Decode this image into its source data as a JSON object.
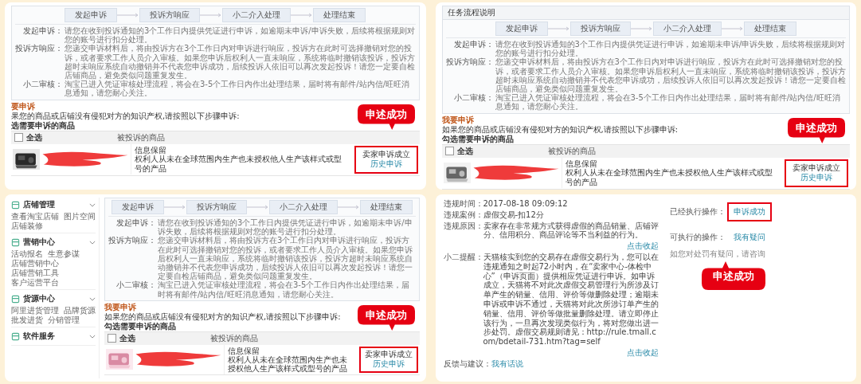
{
  "panels": [
    {
      "kind": "complaint",
      "steps": [
        "发起申诉",
        "投诉方响应",
        "小二介入处理",
        "处理结束"
      ],
      "notes": [
        {
          "label": "发起申诉：",
          "text": "请您在收到投诉通知的3个工作日内提供凭证进行申诉，如逾期未申诉/申诉失败，后续将根据规则对您的账号进行扣分处理。"
        },
        {
          "label": "投诉方响应：",
          "text": "您递交申诉材料后，将由投诉方在3个工作日内对申诉进行响应，投诉方在此时可选择撤销对您的投诉，或者要求工作人员介入审核。如果您申诉后权利人一直未响应，系统将临时撤销该投诉，投诉方超时未响应系统自动撤销并不代表您申诉成功，后续投诉人依旧可以再次发起投诉！请您一定要自检店铺商品，避免类似问题重复发生。"
        },
        {
          "label": "小二审核：",
          "text": "淘宝已进入凭证审核处理流程，将会在3-5个工作日内作出处理结果，届时将有邮件/站内信/旺旺消息通知，请您耐心关注。"
        }
      ],
      "section_title": "要申诉",
      "intro": "果您的商品或店铺没有侵犯对方的知识产权,请按照以下步骤申诉:",
      "select_label": "选需要申诉的商品",
      "table": {
        "select_all": {
          "label": "全选",
          "checked": false
        },
        "column": "被投诉的商品",
        "rows": [
          {
            "description_title": "信息保留",
            "description": "权利人从未在全球范围内生产也未授权他人生产该样式或型号的产品",
            "status": "卖家申诉成立",
            "link": "历史申诉",
            "highlighted": true
          }
        ]
      },
      "callout": "申述成功"
    },
    {
      "kind": "complaint",
      "header": "任务流程说明",
      "steps": [
        "发起申诉",
        "投诉方响应",
        "小二介入处理",
        "处理结束"
      ],
      "notes": [
        {
          "label": "发起申诉：",
          "text": "请您在收到投诉通知的3个工作日内提供凭证进行申诉，如逾期未申诉/申诉失败，后续将根据规则对您的账号进行扣分处理。"
        },
        {
          "label": "投诉方响应：",
          "text": "您递交申诉材料后，将由投诉方在3个工作日内对申诉进行响应，投诉方在此时可选择撤销对您的投诉，或者要求工作人员介入审核。如果您申诉后权利人一直未响应，系统将临时撤销该投诉，投诉方超时未响应系统自动撤销并不代表您申诉成功，后续投诉人依旧可以再次发起投诉！请您一定要自检店铺商品，避免类似问题重复发生。"
        },
        {
          "label": "小二审核：",
          "text": "淘宝已进入凭证审核处理流程，将会在3-5个工作日内作出处理结果，届时将有邮件/站内信/旺旺消息通知，请您耐心关注。"
        }
      ],
      "section_title": "我要申诉",
      "intro": "如果您的商品或店铺没有侵犯对方的知识产权,请按照以下步骤申诉:",
      "select_label": "勾选需要申诉的商品",
      "table": {
        "select_all": {
          "label": "全选",
          "checked": false
        },
        "column": "被投诉的商品",
        "rows": [
          {
            "description_title": "信息保留",
            "description": "权利人从未在全球范围内生产也未授权他人生产该样式或型号的产品",
            "status": "卖家申诉成立",
            "link": "历史申诉",
            "highlighted": true
          }
        ]
      },
      "callout": "申述成功"
    },
    {
      "kind": "complaint",
      "sidebar": [
        {
          "title": "店铺管理",
          "items": [
            "查看淘宝店铺",
            "图片空间",
            "店铺装修"
          ]
        },
        {
          "title": "营销中心",
          "items": [
            "活动报名",
            "生意参谋",
            "店铺营销中心",
            "店铺营销工具",
            "客户运营平台"
          ]
        },
        {
          "title": "货源中心",
          "items": [
            "阿里进货管理",
            "品牌货源",
            "批发进货",
            "分销管理"
          ]
        },
        {
          "title": "软件服务"
        }
      ],
      "steps": [
        "发起申诉",
        "投诉方响应",
        "小二介入处理",
        "处理结束"
      ],
      "notes": [
        {
          "label": "发起申诉：",
          "text": "请您在收到投诉通知的3个工作日内提供凭证进行申诉，如逾期未申诉/申诉失败，后续将根据规则对您的账号进行扣分处理。"
        },
        {
          "label": "投诉方响应：",
          "text": "您递交申诉材料后，将由投诉方在3个工作日内对申诉进行响应，投诉方在此时可选择撤销对您的投诉，或者要求工作人员介入审核。如果您申诉后权利人一直未响应，系统将临时撤销该投诉，投诉方超时未响应系统自动撤销并不代表您申诉成功，后续投诉人依旧可以再次发起投诉！请您一定要自检店铺商品，避免类似问题重复发生。"
        },
        {
          "label": "小二审核：",
          "text": "淘宝已进入凭证审核处理流程，将会在3-5个工作日内作出处理结果，届时将有邮件/站内信/旺旺消息通知，请您耐心关注。"
        }
      ],
      "section_title": "我要申诉",
      "intro": "如果您的商品或店铺没有侵犯对方的知识产权,请按照以下步骤申诉:",
      "select_label": "勾选需要申诉的商品",
      "table": {
        "select_all": {
          "label": "全选",
          "checked": false
        },
        "column": "被投诉的商品",
        "rows": [
          {
            "description_title": "信息保留",
            "description": "权利人从未在全球范围内生产也未授权他人生产该样式或型号的产品",
            "status": "卖家申诉成立",
            "link": "历史申诉",
            "highlighted": true
          }
        ]
      },
      "callout": "申述成功"
    },
    {
      "kind": "violation",
      "fields": [
        {
          "kind": "field",
          "label": "违规时间：",
          "value": "2017-08-18 09:09:12"
        },
        {
          "kind": "field",
          "label": "违规案例：",
          "value": "虚假交易-扣12分"
        },
        {
          "kind": "field",
          "label": "违规原因：",
          "value": "卖家存在非常规方式获得虚假的商品销量、店铺评分、信用积分、商品评论等不当利益的行为。"
        },
        {
          "kind": "toggle",
          "text": "点击收起"
        },
        {
          "kind": "field",
          "label": "小二提醒：",
          "value": "天猫核实到您的交易存在虚假交易行为，您可以在违规通知之时起72小时内，在“卖家中心-体检中心”（申诉页面）提供相应凭证进行申诉。如申诉成立，天猫将不对此次虚假交易管理行为所涉及订单产生的销量、信用、评价等做删除处理；逾期未申诉或申诉不通过，天猫将对此次所涉订单产生的销量、信用、评价等做批量删除处理。请立即停止该行为，一旦再次发现类似行为，将对您做出进一步处罚。虚假交易规则请见：http://rule.tmall.com/bdetail-731.htm?tag=self"
        },
        {
          "kind": "toggle",
          "text": "点击收起"
        },
        {
          "kind": "link",
          "label": "反馈与建议：",
          "link": "我有话说"
        }
      ],
      "actions": [
        {
          "label": "已经执行操作：",
          "link": "申诉成功",
          "highlighted": true
        },
        {
          "label": "可执行的操作：",
          "link": "我有疑问",
          "note": "如您对处罚有疑问，请咨询",
          "highlighted": false
        }
      ],
      "callout": "申述成功"
    }
  ]
}
